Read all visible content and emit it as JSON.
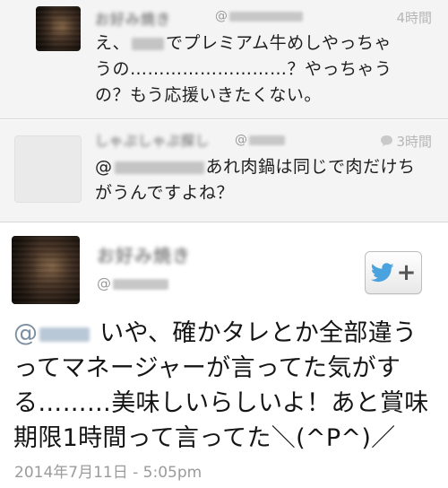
{
  "replies": [
    {
      "name": "お好み焼き",
      "handle_prefix": "@",
      "time": "4時間",
      "text_lines": [
        "え、",
        "でプレミアム牛めしやっちゃ",
        "うの………………………？やっちゃう",
        "の？もう応援いきたくない。"
      ]
    },
    {
      "name": "しゃぶしゃぶ探し",
      "handle_prefix": "@",
      "time": "3時間",
      "text_lines": [
        "@",
        "あれ肉鍋は同じで肉だけち",
        "がうんですよね？"
      ]
    }
  ],
  "main_tweet": {
    "name": "お好み焼き",
    "handle_prefix": "@",
    "mention_prefix": "@",
    "text_lines": [
      "いや、確かタレとか全部違う",
      "ってマネージャーが言ってた気がす",
      "る………美味しいらしいよ！あと賞味",
      "期限1時間って言ってた＼(^P^)／"
    ],
    "timestamp": "2014年7月11日 - 5:05pm"
  },
  "follow_button": {
    "icon": "twitter-bird-icon",
    "plus": "+"
  },
  "colors": {
    "twitter_blue": "#4aa3df",
    "mention": "#7d8fa1",
    "muted": "#9b9b9b"
  }
}
